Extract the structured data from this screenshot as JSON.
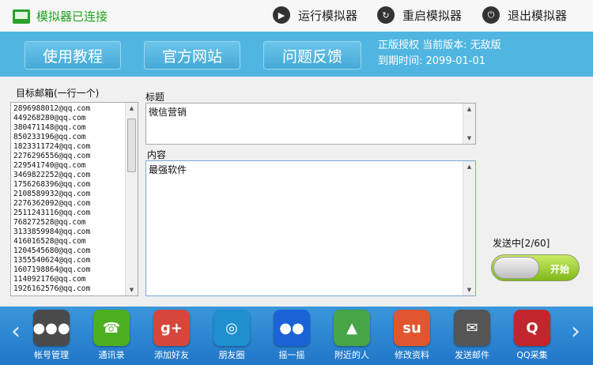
{
  "status": {
    "text": "模拟器已连接",
    "icon": "monitor-icon"
  },
  "top_actions": [
    {
      "label": "运行模拟器",
      "icon": "play-icon"
    },
    {
      "label": "重启模拟器",
      "icon": "restart-icon"
    },
    {
      "label": "退出模拟器",
      "icon": "power-icon"
    }
  ],
  "nav": [
    "使用教程",
    "官方网站",
    "问题反馈"
  ],
  "license": {
    "line1": "正版授权 当前版本: 无敌版",
    "line2": "到期时间: 2099-01-01"
  },
  "target": {
    "label": "目标邮箱(一行一个)",
    "emails": [
      "2896988012@qq.com",
      "449268280@qq.com",
      "380471148@qq.com",
      "850233196@qq.com",
      "1823311724@qq.com",
      "2276296556@qq.com",
      "229541740@qq.com",
      "3469822252@qq.com",
      "1756268396@qq.com",
      "2108589932@qq.com",
      "2276362092@qq.com",
      "2511243116@qq.com",
      "768272528@qq.com",
      "3133859984@qq.com",
      "416016528@qq.com",
      "1204545680@qq.com",
      "1355540624@qq.com",
      "1607198864@qq.com",
      "114092176@qq.com",
      "1926162576@qq.com"
    ]
  },
  "title_field": {
    "label": "标题",
    "value": "微信营销"
  },
  "content_field": {
    "label": "内容",
    "value": "最强软件"
  },
  "sending": {
    "label": "发送中[2/60]",
    "toggle_label": "开始"
  },
  "dock": [
    {
      "label": "帐号管理",
      "icon": "group-icon",
      "color": "#4a4a4a",
      "glyph": "●●●"
    },
    {
      "label": "通讯录",
      "icon": "contacts-icon",
      "color": "#4caf1f",
      "glyph": "☎"
    },
    {
      "label": "添加好友",
      "icon": "google-plus-icon",
      "color": "#d7463a",
      "glyph": "g+"
    },
    {
      "label": "朋友圈",
      "icon": "friends-circle-icon",
      "color": "#1f8fd0",
      "glyph": "◎"
    },
    {
      "label": "摇一摇",
      "icon": "flickr-icon",
      "color": "#1a63d6",
      "glyph": "●●"
    },
    {
      "label": "附近的人",
      "icon": "location-icon",
      "color": "#47a548",
      "glyph": "▲"
    },
    {
      "label": "修改资料",
      "icon": "stumble-icon",
      "color": "#e2562f",
      "glyph": "su"
    },
    {
      "label": "发送邮件",
      "icon": "mail-icon",
      "color": "#555555",
      "glyph": "✉"
    },
    {
      "label": "QQ采集",
      "icon": "quora-icon",
      "color": "#c0262c",
      "glyph": "Q"
    }
  ]
}
